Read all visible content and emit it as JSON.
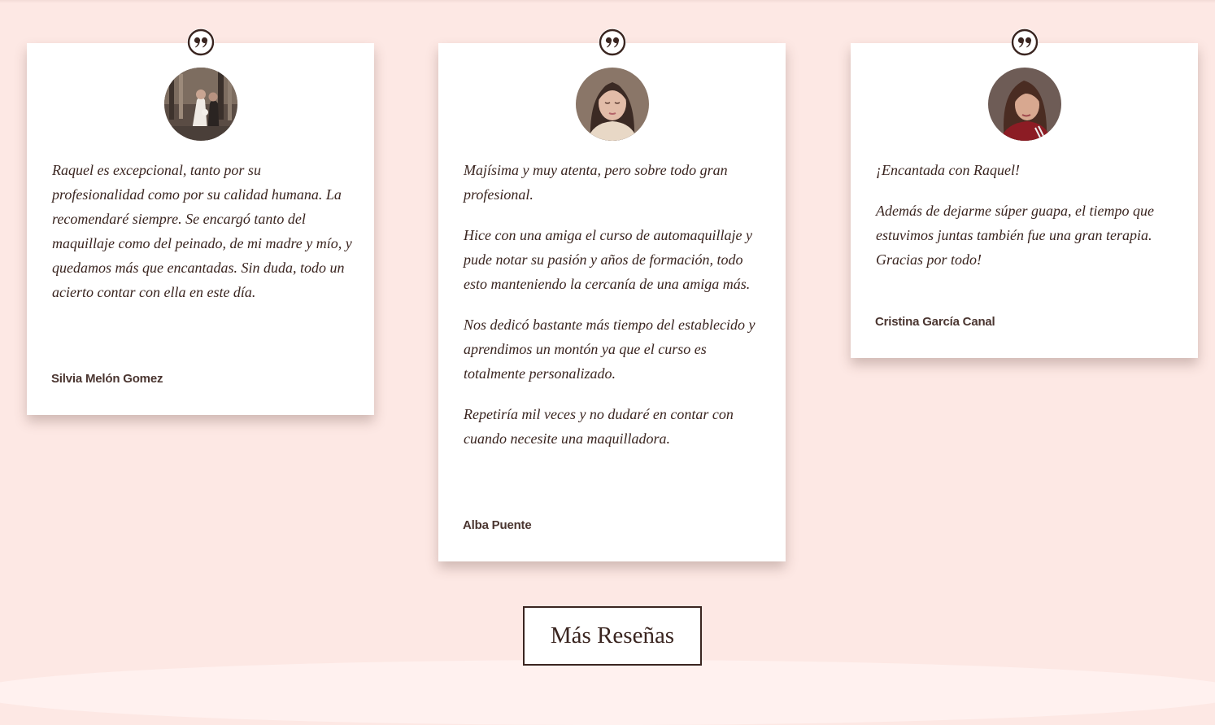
{
  "reviews": [
    {
      "paragraphs": [
        "Raquel es excepcional, tanto por su profesionalidad como por su calidad humana. La recomendaré siempre. Se encargó tanto del maquillaje como del peinado, de mi madre y mío, y quedamos más que encantadas. Sin duda, todo un acierto contar con ella en este día."
      ],
      "author": "Silvia Melón Gomez"
    },
    {
      "paragraphs": [
        "Majísima y muy atenta, pero sobre todo gran profesional.",
        "Hice con una amiga el curso de automaquillaje y pude notar su pasión y años de formación, todo esto manteniendo la cercanía de una amiga más.",
        "Nos dedicó bastante más tiempo del establecido y aprendimos un montón ya que el curso es totalmente personalizado.",
        "Repetiría mil veces y no dudaré en contar con cuando necesite una maquilladora."
      ],
      "author": "Alba Puente"
    },
    {
      "paragraphs": [
        "¡Encantada con Raquel!",
        "Además de dejarme súper guapa, el tiempo que estuvimos juntas también fue una gran terapia. Gracias por todo!"
      ],
      "author": "Cristina García Canal"
    }
  ],
  "more_button": {
    "label": "Más Reseñas"
  },
  "icons": {
    "quote": "quote-icon",
    "avatar": "avatar-photo"
  },
  "colors": {
    "background": "#fde8e4",
    "card": "#ffffff",
    "text": "#3a2520"
  }
}
